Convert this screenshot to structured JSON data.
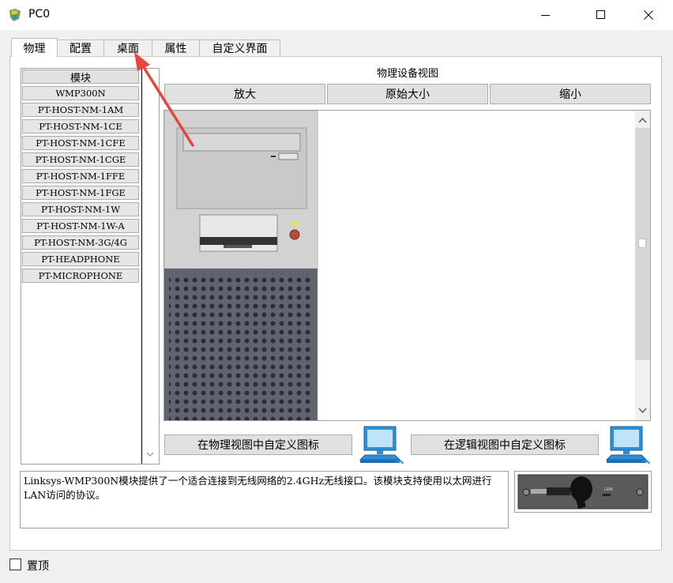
{
  "window": {
    "title": "PC0",
    "controls": [
      "minimize-icon",
      "maximize-icon",
      "close-icon"
    ]
  },
  "tabs": [
    {
      "label": "物理",
      "active": true
    },
    {
      "label": "配置",
      "active": false
    },
    {
      "label": "桌面",
      "active": false
    },
    {
      "label": "属性",
      "active": false
    },
    {
      "label": "自定义界面",
      "active": false
    }
  ],
  "modules": {
    "header": "模块",
    "items": [
      "WMP300N",
      "PT-HOST-NM-1AM",
      "PT-HOST-NM-1CE",
      "PT-HOST-NM-1CFE",
      "PT-HOST-NM-1CGE",
      "PT-HOST-NM-1FFE",
      "PT-HOST-NM-1FGE",
      "PT-HOST-NM-1W",
      "PT-HOST-NM-1W-A",
      "PT-HOST-NM-3G/4G",
      "PT-HEADPHONE",
      "PT-MICROPHONE"
    ]
  },
  "physical_view": {
    "title": "物理设备视图",
    "zoom_in": "放大",
    "original_size": "原始大小",
    "zoom_out": "缩小"
  },
  "customize": {
    "physical_icon": "在物理视图中自定义图标",
    "logical_icon": "在逻辑视图中自定义图标"
  },
  "description": "Linksys-WMP300N模块提供了一个适合连接到无线网络的2.4GHz无线接口。该模块支持使用以太网进行LAN访问的协议。",
  "module_image_label": "LINK",
  "footer": {
    "always_on_top": "置顶",
    "checked": false
  },
  "colors": {
    "annotation_arrow": "#e8453c",
    "pc_case": "#d4d4d4",
    "pc_grille": "#5f6470",
    "monitor_icon": "#2e8fd8"
  }
}
